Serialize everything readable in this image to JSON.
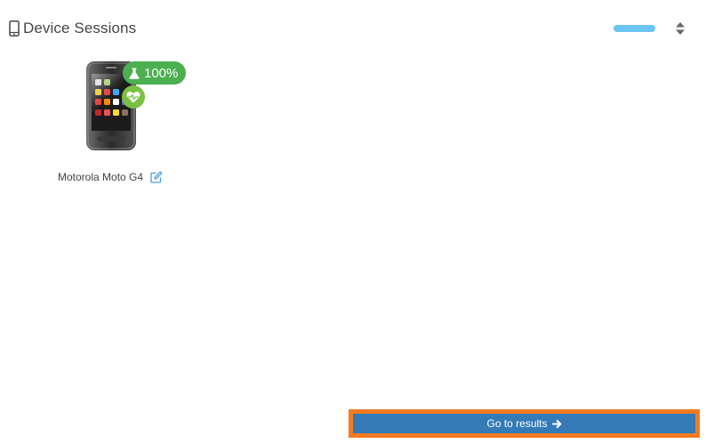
{
  "header": {
    "icon": "mobile-phone-icon",
    "title": "Device Sessions"
  },
  "controls": {
    "toggle_color": "#6cc4f0",
    "sort_icon": "sort-icon"
  },
  "device": {
    "name": "Motorola Moto G4",
    "score": "100%",
    "score_icon": "flask-icon",
    "health_icon": "heart-pulse-icon",
    "edit_icon": "edit-icon"
  },
  "footer": {
    "button_label": "Go to results",
    "button_icon": "arrow-right-icon"
  },
  "colors": {
    "score_badge": "#4caf50",
    "health_badge": "#7ac142",
    "button": "#337ab7",
    "highlight": "#f47b20"
  }
}
